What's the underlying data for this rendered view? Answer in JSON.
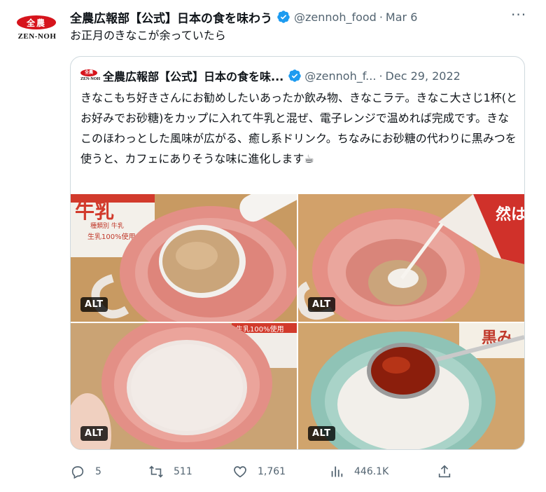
{
  "author": {
    "logo_text": "全農",
    "logo_brand": "ZEN-NOH",
    "display_name": "全農広報部【公式】日本の食を味わう",
    "handle": "@zennoh_food",
    "date": "Mar 6"
  },
  "tweet_text": "お正月のきなこが余っていたら",
  "quoted": {
    "display_name": "全農広報部【公式】日本の食を味...",
    "handle": "@zennoh_f...",
    "date": "Dec 29, 2022",
    "body": "きなこもち好きさんにお勧めしたいあったか飲み物、きなこラテ。きなこ大さじ1杯(とお好みでお砂糖)をカップに入れて牛乳と混ぜ、電子レンジで温めれば完成です。きなこのほわっとした風味が広がる、癒し系ドリンク。ちなみにお砂糖の代わりに黒みつを使うと、カフェにありそうな味に進化します☕",
    "photos": [
      {
        "alt_label": "ALT",
        "carton_text": "牛乳",
        "carton_sub": "種類別 牛乳",
        "carton_sub2": "生乳100%使用"
      },
      {
        "alt_label": "ALT",
        "carton_text": "然は"
      },
      {
        "alt_label": "ALT",
        "carton_text": "生乳100%使用"
      },
      {
        "alt_label": "ALT",
        "carton_text": "黒み"
      }
    ]
  },
  "actions": {
    "replies": "5",
    "retweets": "511",
    "likes": "1,761",
    "views": "446.1K"
  },
  "colors": {
    "verified": "#1d9bf0",
    "muted": "#536471",
    "logo_red": "#d6141c"
  }
}
